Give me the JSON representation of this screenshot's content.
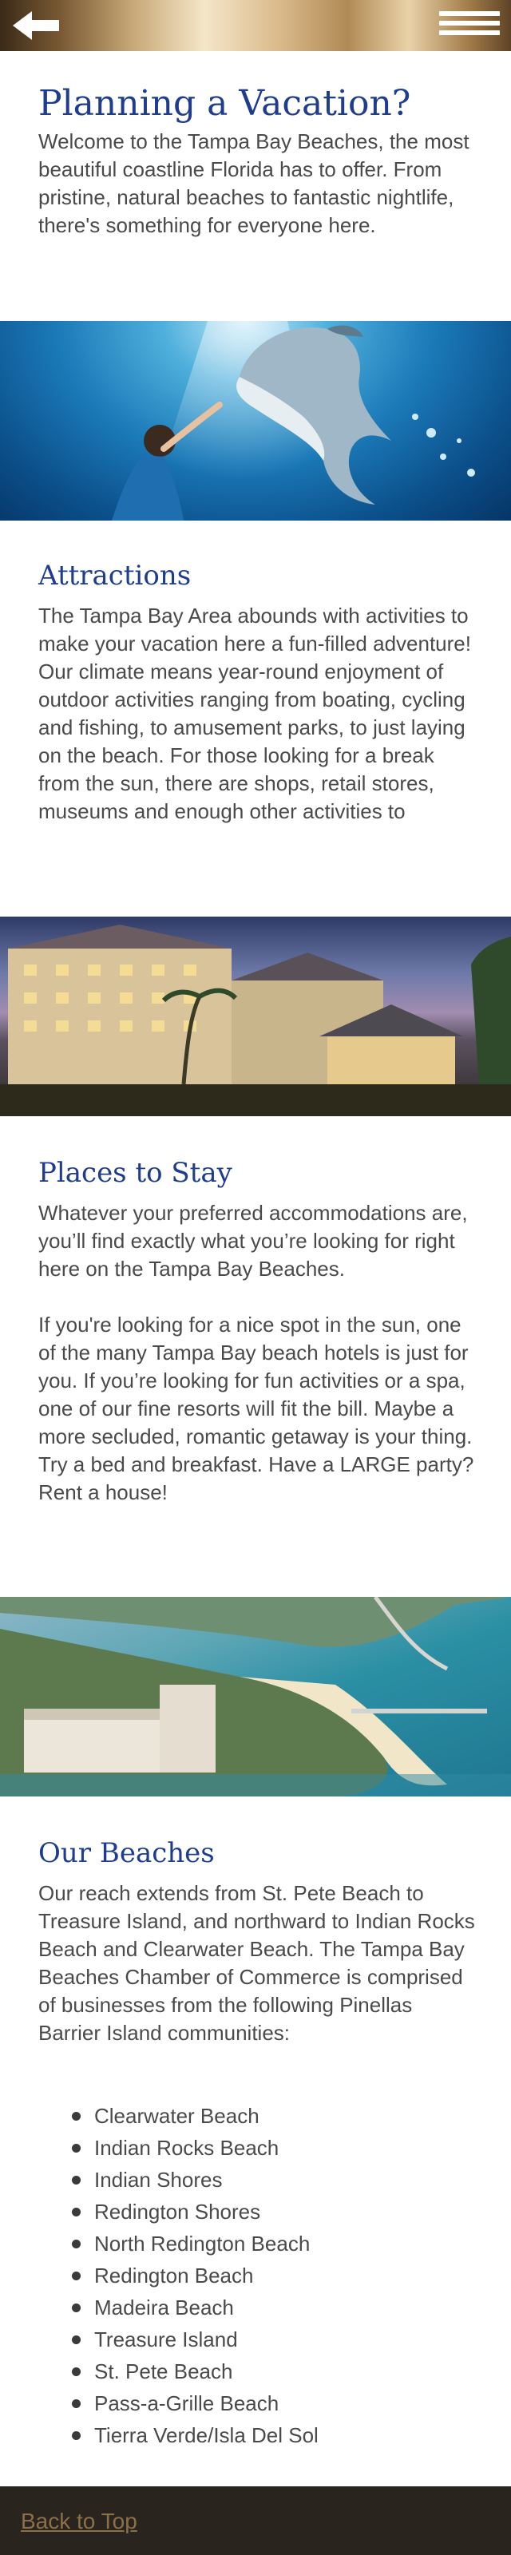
{
  "header": {
    "back_icon": "back-arrow-icon",
    "menu_icon": "hamburger-menu-icon"
  },
  "intro": {
    "title": "Planning a Vacation?",
    "text": "Welcome to the Tampa Bay Beaches, the most beautiful coastline Florida has to offer. From pristine, natural beaches to fantastic nightlife, there's something for everyone here."
  },
  "attractions": {
    "title": "Attractions",
    "text": "The Tampa Bay Area abounds with activities to make your vacation here a fun-filled adventure! Our climate means year-round enjoyment of outdoor activities ranging from boating, cycling and fishing, to amusement parks, to just laying on the beach. For those looking for a break from the sun, there are shops, retail stores, museums and enough other activities to"
  },
  "places": {
    "title": "Places to Stay",
    "text1": "Whatever your preferred accommodations are, you’ll find exactly what you’re looking for right here on the Tampa Bay Beaches.",
    "text2": "If you're looking for a nice spot in the sun, one of the many Tampa Bay beach hotels is just for you. If you’re looking for fun activities or a spa, one of our fine resorts will fit the bill. Maybe a more secluded, romantic getaway is your thing. Try a bed and breakfast. Have a LARGE party? Rent a house!"
  },
  "beaches": {
    "title": "Our Beaches",
    "text": "Our reach extends from St. Pete Beach to Treasure Island, and northward to Indian Rocks Beach and Clearwater Beach. The Tampa Bay Beaches Chamber of Commerce is comprised of businesses from the following Pinellas Barrier Island communities:",
    "items": [
      "Clearwater Beach",
      "Indian Rocks Beach",
      "Indian Shores",
      "Redington Shores",
      "North Redington Beach",
      "Redington Beach",
      "Madeira Beach",
      "Treasure Island",
      "St. Pete Beach",
      "Pass-a-Grille Beach",
      "Tierra Verde/Isla Del Sol"
    ]
  },
  "footer": {
    "back_to_top": "Back to Top"
  },
  "colors": {
    "heading": "#1e3d8f",
    "body_text": "#4a4a4a",
    "footer_bg": "#2a241e",
    "footer_link": "#8a7048"
  }
}
